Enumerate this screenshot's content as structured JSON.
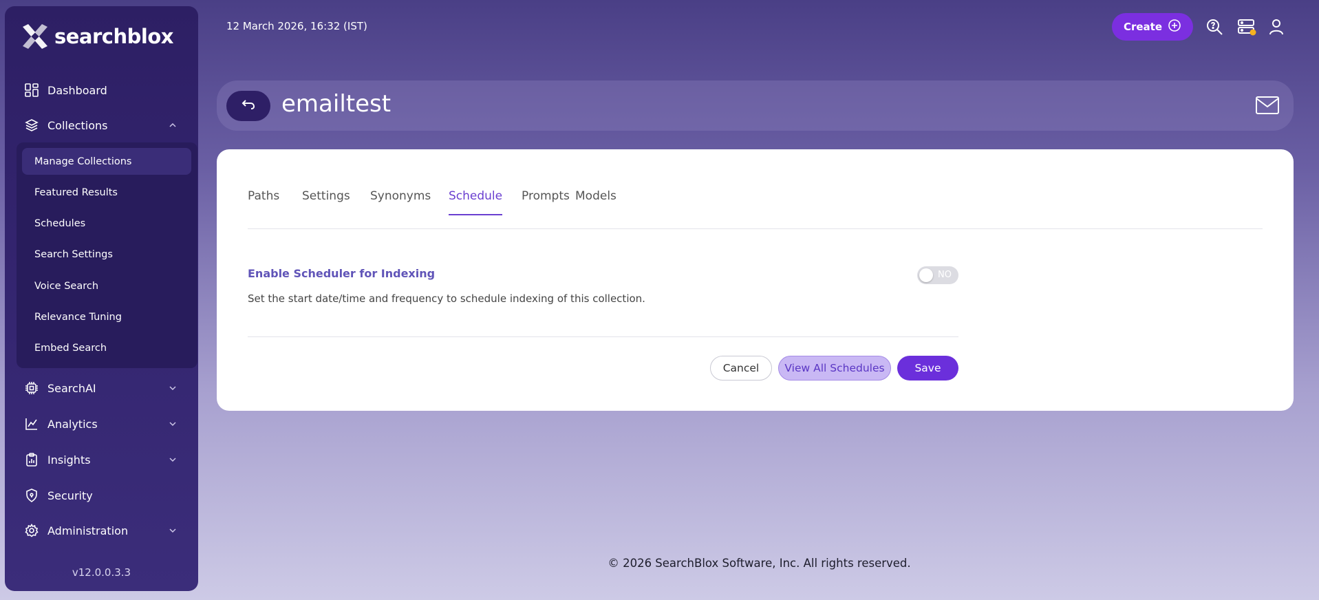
{
  "app": {
    "brand": "searchblox",
    "version": "v12.0.0.3.3",
    "datetime": "12 March 2026, 16:32 (IST)",
    "accent_color": "#7b2fe0"
  },
  "topbar": {
    "create_label": "Create",
    "icons": [
      "search-icon",
      "server-status-icon",
      "user-icon"
    ]
  },
  "sidebar": {
    "items": [
      {
        "label": "Dashboard",
        "icon": "dashboard-icon"
      },
      {
        "label": "Collections",
        "icon": "layers-icon"
      },
      {
        "label": "SearchAI",
        "icon": "chip-icon"
      },
      {
        "label": "Analytics",
        "icon": "analytics-icon"
      },
      {
        "label": "Insights",
        "icon": "clipboard-icon"
      },
      {
        "label": "Security",
        "icon": "shield-icon"
      },
      {
        "label": "Administration",
        "icon": "gear-icon"
      }
    ],
    "collections_submenu": [
      {
        "label": "Manage Collections",
        "active": true
      },
      {
        "label": "Featured Results"
      },
      {
        "label": "Schedules"
      },
      {
        "label": "Search Settings"
      },
      {
        "label": "Voice Search"
      },
      {
        "label": "Relevance Tuning"
      },
      {
        "label": "Embed Search"
      }
    ]
  },
  "header": {
    "title": "emailtest"
  },
  "tabs": [
    "Paths",
    "Settings",
    "Synonyms",
    "Schedule",
    "Prompts",
    "Models"
  ],
  "active_tab": "Schedule",
  "scheduler": {
    "title": "Enable Scheduler for Indexing",
    "description": "Set the start date/time and frequency to schedule indexing of this collection.",
    "toggle_label": "NO",
    "enabled": false
  },
  "actions": {
    "cancel": "Cancel",
    "view_all": "View All Schedules",
    "save": "Save"
  },
  "footer": {
    "copyright": "© 2026 SearchBlox Software, Inc. All rights reserved."
  }
}
